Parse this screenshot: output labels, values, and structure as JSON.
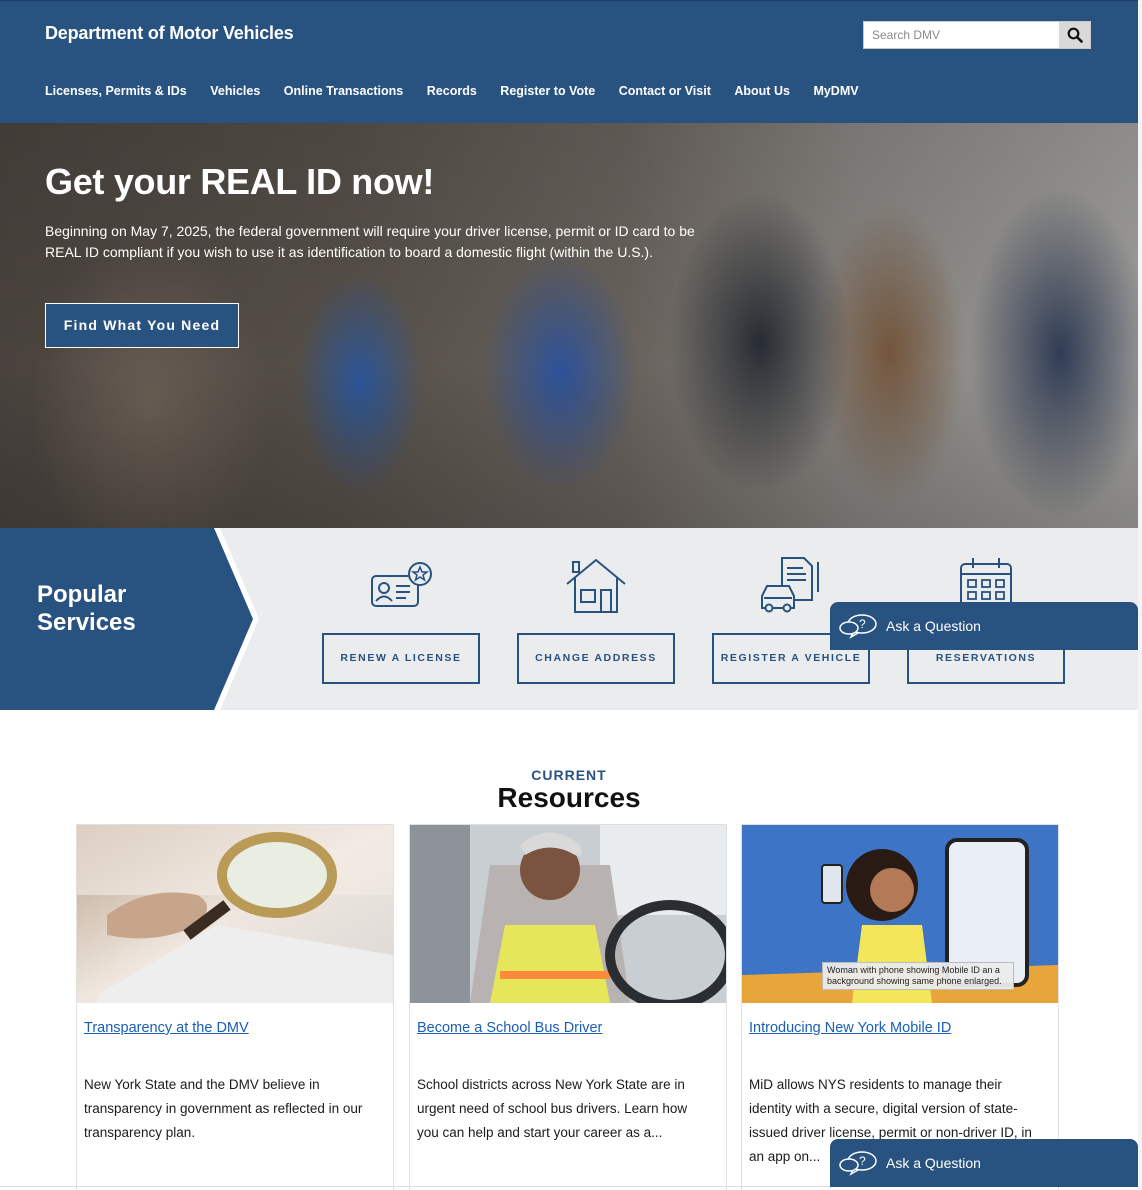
{
  "header": {
    "site_title": "Department of Motor Vehicles",
    "search_placeholder": "Search DMV",
    "nav": [
      "Licenses, Permits & IDs",
      "Vehicles",
      "Online Transactions",
      "Records",
      "Register to Vote",
      "Contact or Visit",
      "About Us",
      "MyDMV"
    ]
  },
  "hero": {
    "title": "Get your REAL ID now!",
    "text": "Beginning on May 7, 2025, the federal government will require your driver license, permit or ID card to be REAL ID compliant if you wish to use it as identification to board a domestic flight (within the U.S.).",
    "button": "Find What You Need"
  },
  "popular_services": {
    "title_line1": "Popular",
    "title_line2": "Services",
    "items": [
      {
        "label": "RENEW A LICENSE",
        "icon": "id-card-icon"
      },
      {
        "label": "CHANGE ADDRESS",
        "icon": "house-icon"
      },
      {
        "label": "REGISTER A VEHICLE",
        "icon": "car-document-icon"
      },
      {
        "label": "RESERVATIONS",
        "icon": "calendar-icon"
      }
    ]
  },
  "ask": {
    "label": "Ask a Question"
  },
  "resources": {
    "eyebrow": "CURRENT",
    "title": "Resources",
    "cards": [
      {
        "link": "Transparency at the DMV",
        "text": "New York State and the DMV believe in transparency in government as reflected in our transparency plan."
      },
      {
        "link": "Become a School Bus Driver",
        "text": "School districts across New York State are in urgent need of school bus drivers. Learn how you can help and start your career as a..."
      },
      {
        "link": "Introducing New York Mobile ID",
        "text": "MiD allows NYS residents to manage their identity with a secure, digital version of state-issued driver license, permit or non-driver ID, in an app on...",
        "caption": "Woman with phone showing Mobile ID an a background showing same phone enlarged."
      }
    ]
  },
  "colors": {
    "brand": "#285280",
    "link": "#1a5fb4",
    "services_bg": "#ebeced"
  }
}
